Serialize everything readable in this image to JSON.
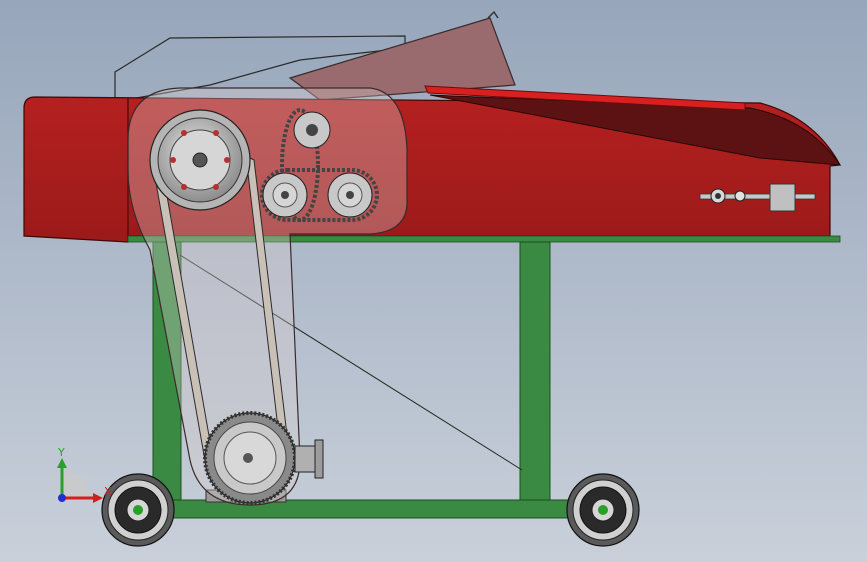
{
  "colors": {
    "background_top": "#9aa8bd",
    "background_bottom": "#c6ced8",
    "frame_green": "#3a8a44",
    "body_red": "#a31c1c",
    "body_red_dark": "#7e1313",
    "hopper_red": "#5a1010",
    "belt_cover": "#c8c6c6",
    "rubber_black": "#1e1e1e",
    "steel": "#b8b8b8"
  },
  "triad": {
    "y_label": "Y",
    "x_label": "X",
    "y_color": "#2aa02a",
    "x_color": "#d02020",
    "z_color": "#2030d0"
  },
  "icons": {
    "wheel": "wheel-icon",
    "pulley": "pulley-icon",
    "sprocket": "sprocket-icon",
    "gear": "gear-icon"
  }
}
